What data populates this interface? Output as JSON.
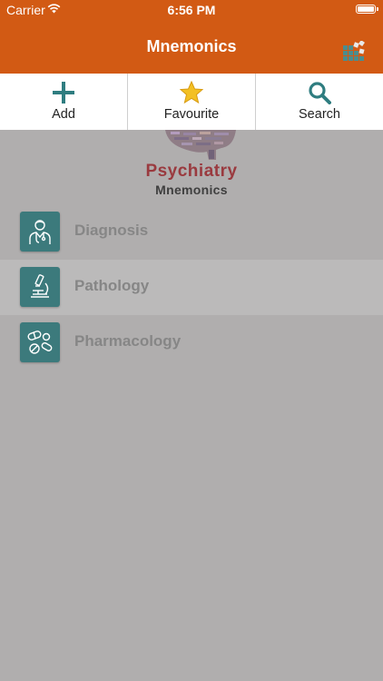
{
  "status_bar": {
    "carrier": "Carrier",
    "time": "6:56 PM"
  },
  "nav": {
    "title": "Mnemonics",
    "grid_icon": "grid-icon"
  },
  "toolbar": {
    "items": [
      {
        "label": "Add",
        "icon": "plus-icon"
      },
      {
        "label": "Favourite",
        "icon": "star-icon"
      },
      {
        "label": "Search",
        "icon": "search-icon"
      }
    ]
  },
  "logo": {
    "title": "Psychiatry",
    "subtitle": "Mnemonics"
  },
  "menu": {
    "items": [
      {
        "label": "Diagnosis",
        "icon": "doctor-icon"
      },
      {
        "label": "Pathology",
        "icon": "microscope-icon"
      },
      {
        "label": "Pharmacology",
        "icon": "pills-icon"
      }
    ]
  },
  "colors": {
    "accent": "#d25a14",
    "teal": "#3c7a7c",
    "background": "#b0aeae"
  }
}
